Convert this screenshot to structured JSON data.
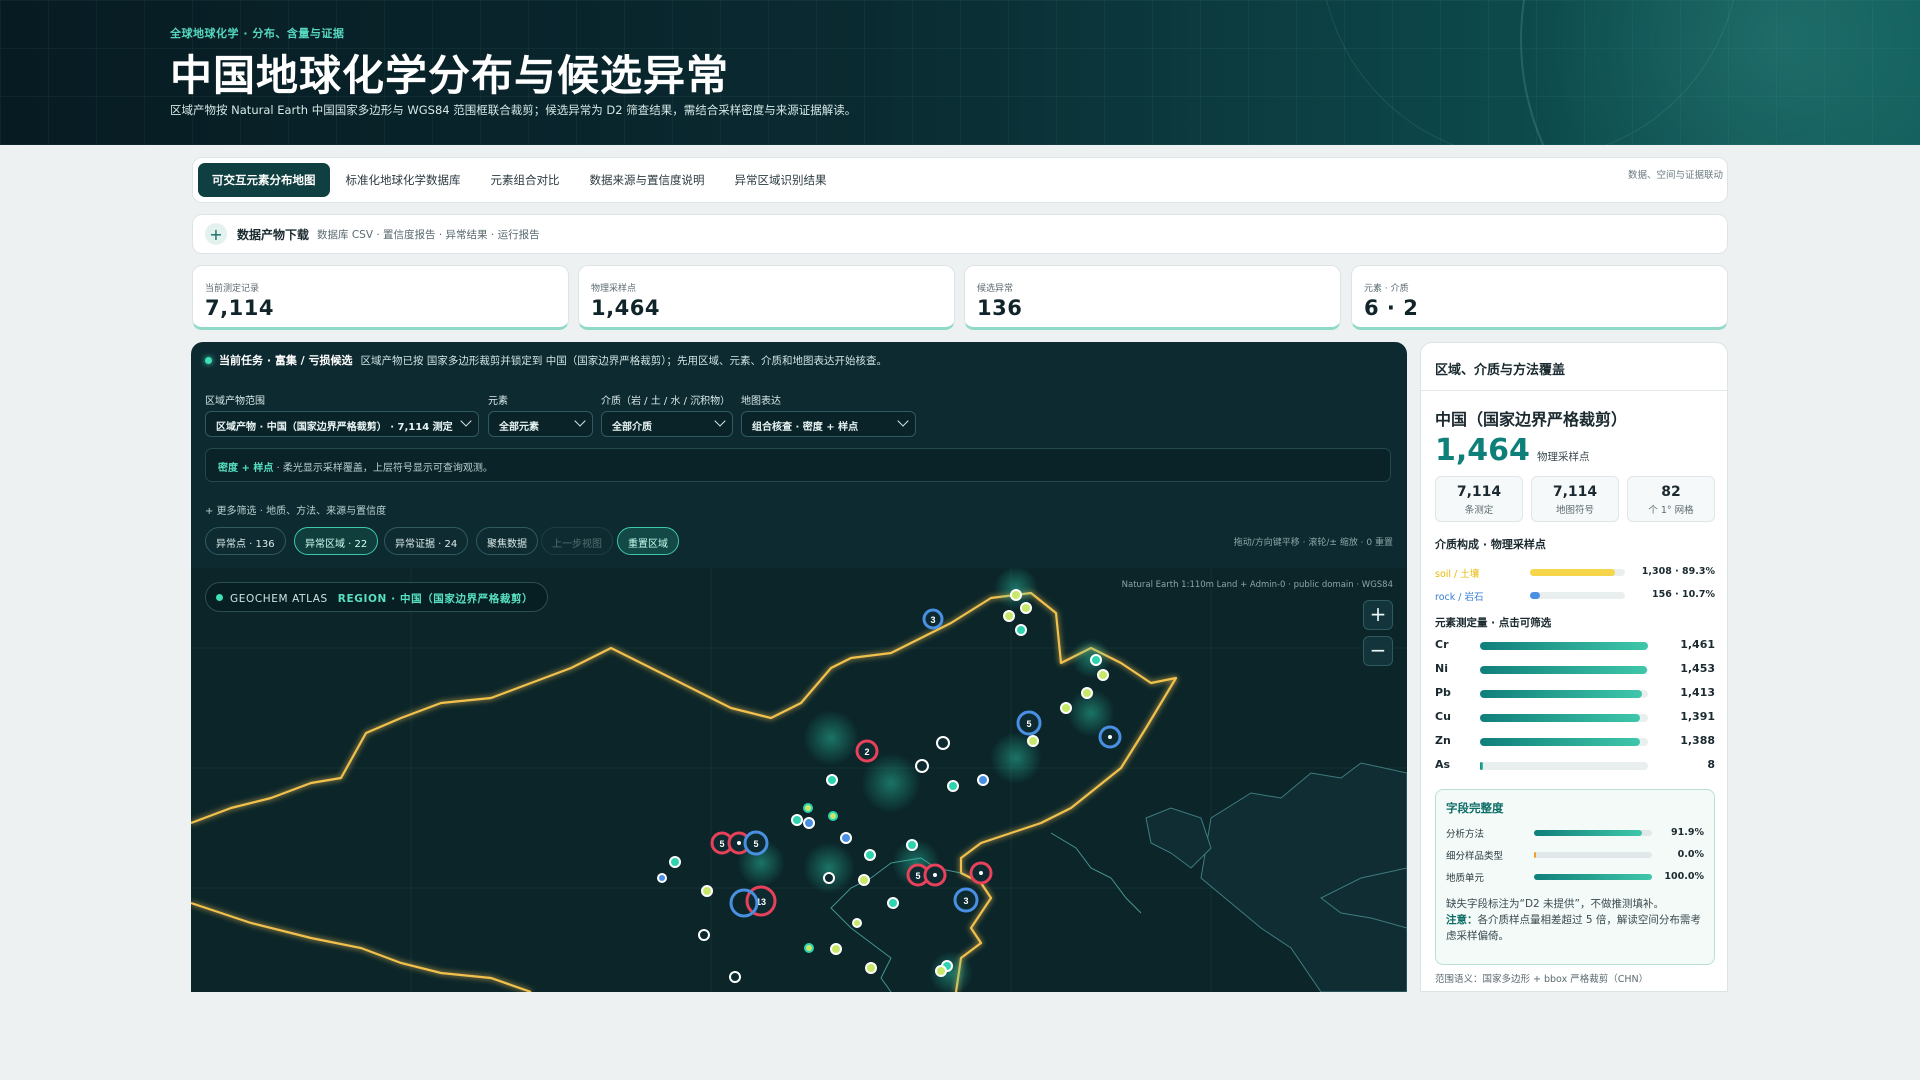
{
  "header": {
    "kicker": "全球地球化学 · 分布、含量与证据",
    "title": "中国地球化学分布与候选异常",
    "subtitle": "区域产物按 Natural Earth 中国国家多边形与 WGS84 范围框联合裁剪；候选异常为 D2 筛查结果，需结合采样密度与来源证据解读。"
  },
  "tabs": [
    {
      "label": "可交互元素分布地图",
      "active": true
    },
    {
      "label": "标准化地球化学数据库"
    },
    {
      "label": "元素组合对比"
    },
    {
      "label": "数据来源与置信度说明"
    },
    {
      "label": "异常区域识别结果"
    }
  ],
  "tabs_right": "数据、空间与证据联动",
  "download": {
    "title": "数据产物下载",
    "desc": "数据库 CSV · 置信度报告 · 异常结果 · 运行报告"
  },
  "stats": [
    {
      "label": "当前测定记录",
      "value": "7,114"
    },
    {
      "label": "物理采样点",
      "value": "1,464"
    },
    {
      "label": "候选异常",
      "value": "136"
    },
    {
      "label": "元素 · 介质",
      "value": "6 · 2"
    }
  ],
  "task": {
    "title": "当前任务 · 富集 / 亏损候选",
    "desc": "区域产物已按 国家多边形裁剪并锁定到 中国（国家边界严格裁剪）；先用区域、元素、介质和地图表达开始核查。"
  },
  "filters": {
    "region_label": "区域产物范围",
    "region_value": "区域产物 · 中国（国家边界严格裁剪） · 7,114 测定",
    "element_label": "元素",
    "element_value": "全部元素",
    "medium_label": "介质（岩 / 土 / 水 / 沉积物）",
    "medium_value": "全部介质",
    "view_label": "地图表达",
    "view_value": "组合核查 · 密度 + 样点"
  },
  "hint": {
    "strong": "密度 + 样点",
    "text": " · 柔光显示采样覆盖，上层符号显示可查询观测。"
  },
  "more_filters": "+ 更多筛选 · 地质、方法、来源与置信度",
  "chips": [
    "异常点 · 136",
    "异常区域 · 22",
    "异常证据 · 24",
    "聚焦数据",
    "上一步视图",
    "重置区域"
  ],
  "map_help": "拖动/方向键平移 · 滚轮/± 缩放 · 0 重置",
  "map": {
    "atlas_label": "GEOCHEM ATLAS",
    "atlas_region": "REGION · 中国（国家边界严格裁剪）",
    "credit": "Natural Earth 1:110m Land + Admin-0 · public domain · WGS84",
    "zoom_in": "+",
    "zoom_out": "−",
    "clusters": [
      "3",
      "5",
      "2",
      "5",
      "5",
      "13",
      "5",
      "3"
    ]
  },
  "side": {
    "head": "区域、介质与方法覆盖",
    "region_name": "中国（国家边界严格裁剪）",
    "region_count": "1,464",
    "region_unit": "物理采样点",
    "minis": [
      {
        "value": "7,114",
        "label": "条测定"
      },
      {
        "value": "7,114",
        "label": "地图符号"
      },
      {
        "value": "82",
        "label": "个 1° 网格"
      }
    ],
    "media_title": "介质构成 · 物理采样点",
    "media": [
      {
        "name": "soil / 土壤",
        "value": "1,308 · 89.3%",
        "pct": 89.3,
        "color": "#f5d64a"
      },
      {
        "name": "rock / 岩石",
        "value": "156 · 10.7%",
        "pct": 10.7,
        "color": "#4a90e2"
      }
    ],
    "elements_title": "元素测定量 · 点击可筛选",
    "elements": [
      {
        "name": "Cr",
        "value": "1,461",
        "count": 1461
      },
      {
        "name": "Ni",
        "value": "1,453",
        "count": 1453
      },
      {
        "name": "Pb",
        "value": "1,413",
        "count": 1413
      },
      {
        "name": "Cu",
        "value": "1,391",
        "count": 1391
      },
      {
        "name": "Zn",
        "value": "1,388",
        "count": 1388
      },
      {
        "name": "As",
        "value": "8",
        "count": 8
      }
    ],
    "completeness": {
      "title": "字段完整度",
      "rows": [
        {
          "name": "分析方法",
          "value": "91.9%",
          "pct": 91.9
        },
        {
          "name": "细分样品类型",
          "value": "0.0%",
          "pct": 0.0
        },
        {
          "name": "地质单元",
          "value": "100.0%",
          "pct": 100.0
        }
      ],
      "note1": "缺失字段标注为“D2 未提供”，不做推测填补。",
      "note_strong": "注意：",
      "note2": "各介质样点量相差超过 5 倍，解读空间分布需考虑采样偏倚。"
    },
    "scope": "范围语义：国家多边形 + bbox 严格裁剪（CHN）"
  },
  "colors": {
    "accent": "#0f8079",
    "border_glow": "#f2c14e",
    "anomaly_red": "#e8415a",
    "anomaly_blue": "#4a90e2"
  }
}
